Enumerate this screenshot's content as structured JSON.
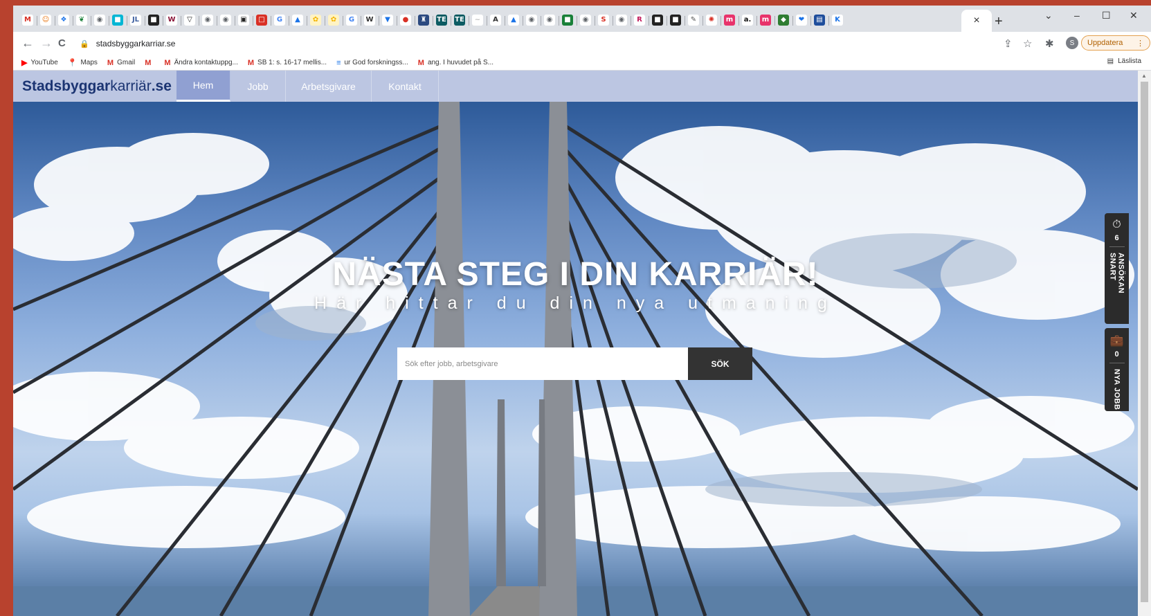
{
  "browser": {
    "tab_favicons": [
      {
        "icon": "gmail-icon",
        "glyph": "M",
        "bg": "#ffffff",
        "fg": "#d93025"
      },
      {
        "icon": "smiley-icon",
        "glyph": "☺",
        "bg": "#ffffff",
        "fg": "#e8710a"
      },
      {
        "icon": "bird-icon",
        "glyph": "❖",
        "bg": "#ffffff",
        "fg": "#1a73e8"
      },
      {
        "icon": "leaf-icon",
        "glyph": "❦",
        "bg": "#ffffff",
        "fg": "#188038"
      },
      {
        "icon": "globe-icon",
        "glyph": "◉",
        "bg": "#ffffff",
        "fg": "#5f6368"
      },
      {
        "icon": "chat-icon",
        "glyph": "■",
        "bg": "#00b6d4",
        "fg": "#ffffff"
      },
      {
        "icon": "jl-icon",
        "glyph": "JL",
        "bg": "#ffffff",
        "fg": "#3d5fa0"
      },
      {
        "icon": "dark-square-icon",
        "glyph": "■",
        "bg": "#222222",
        "fg": "#ffffff"
      },
      {
        "icon": "word-w-icon",
        "glyph": "W",
        "bg": "#ffffff",
        "fg": "#8a1538"
      },
      {
        "icon": "shield-icon",
        "glyph": "▽",
        "bg": "#ffffff",
        "fg": "#222222"
      },
      {
        "icon": "globe-icon",
        "glyph": "◉",
        "bg": "#ffffff",
        "fg": "#5f6368"
      },
      {
        "icon": "globe-icon",
        "glyph": "◉",
        "bg": "#ffffff",
        "fg": "#5f6368"
      },
      {
        "icon": "cup-icon",
        "glyph": "▣",
        "bg": "#ffffff",
        "fg": "#222222"
      },
      {
        "icon": "red-square-icon",
        "glyph": "□",
        "bg": "#d93025",
        "fg": "#ffffff"
      },
      {
        "icon": "google-icon",
        "glyph": "G",
        "bg": "#ffffff",
        "fg": "#4285f4"
      },
      {
        "icon": "drive-icon",
        "glyph": "▲",
        "bg": "#ffffff",
        "fg": "#1a73e8"
      },
      {
        "icon": "flower-icon",
        "glyph": "✿",
        "bg": "#fff3c4",
        "fg": "#f4b400"
      },
      {
        "icon": "flower-icon",
        "glyph": "✿",
        "bg": "#fff3c4",
        "fg": "#f4b400"
      },
      {
        "icon": "google-icon",
        "glyph": "G",
        "bg": "#ffffff",
        "fg": "#4285f4"
      },
      {
        "icon": "wikipedia-icon",
        "glyph": "W",
        "bg": "#ffffff",
        "fg": "#333333"
      },
      {
        "icon": "bookmark-icon",
        "glyph": "▼",
        "bg": "#ffffff",
        "fg": "#1a73e8"
      },
      {
        "icon": "red-circle-icon",
        "glyph": "●",
        "bg": "#ffffff",
        "fg": "#d93025"
      },
      {
        "icon": "crest-icon",
        "glyph": "♜",
        "bg": "#2c4a80",
        "fg": "#ffffff"
      },
      {
        "icon": "te-icon",
        "glyph": "TE",
        "bg": "#0d5c63",
        "fg": "#ffffff"
      },
      {
        "icon": "te-icon",
        "glyph": "TE",
        "bg": "#0d5c63",
        "fg": "#ffffff"
      },
      {
        "icon": "faded-icon",
        "glyph": "~",
        "bg": "#ffffff",
        "fg": "#c0c0c0"
      },
      {
        "icon": "letter-a-icon",
        "glyph": "A",
        "bg": "#ffffff",
        "fg": "#333333"
      },
      {
        "icon": "drive-icon",
        "glyph": "▲",
        "bg": "#ffffff",
        "fg": "#1a73e8"
      },
      {
        "icon": "globe-icon",
        "glyph": "◉",
        "bg": "#ffffff",
        "fg": "#5f6368"
      },
      {
        "icon": "globe-icon",
        "glyph": "◉",
        "bg": "#ffffff",
        "fg": "#5f6368"
      },
      {
        "icon": "green-square-icon",
        "glyph": "■",
        "bg": "#188038",
        "fg": "#ffffff"
      },
      {
        "icon": "globe-icon",
        "glyph": "◉",
        "bg": "#ffffff",
        "fg": "#5f6368"
      },
      {
        "icon": "letter-s-icon",
        "glyph": "S",
        "bg": "#ffffff",
        "fg": "#d93025"
      },
      {
        "icon": "globe-icon",
        "glyph": "◉",
        "bg": "#ffffff",
        "fg": "#5f6368"
      },
      {
        "icon": "r-icon",
        "glyph": "R",
        "bg": "#ffffff",
        "fg": "#c2185b"
      },
      {
        "icon": "dark-doc-icon",
        "glyph": "■",
        "bg": "#222222",
        "fg": "#ffffff"
      },
      {
        "icon": "dark-doc-icon",
        "glyph": "■",
        "bg": "#222222",
        "fg": "#ffffff"
      },
      {
        "icon": "pen-icon",
        "glyph": "✎",
        "bg": "#ffffff",
        "fg": "#555555"
      },
      {
        "icon": "red-flower-icon",
        "glyph": "✺",
        "bg": "#ffffff",
        "fg": "#d93025"
      },
      {
        "icon": "pink-m-icon",
        "glyph": "m",
        "bg": "#e8336b",
        "fg": "#ffffff"
      },
      {
        "icon": "letter-a-icon",
        "glyph": "a.",
        "bg": "#ffffff",
        "fg": "#111111"
      },
      {
        "icon": "pink-m-icon",
        "glyph": "m",
        "bg": "#e8336b",
        "fg": "#ffffff"
      },
      {
        "icon": "map-pin-icon",
        "glyph": "◆",
        "bg": "#2f7d32",
        "fg": "#ffffff"
      },
      {
        "icon": "heart-icon",
        "glyph": "❤",
        "bg": "#ffffff",
        "fg": "#1a73e8"
      },
      {
        "icon": "blue-doc-icon",
        "glyph": "▤",
        "bg": "#1f4e9c",
        "fg": "#ffffff"
      },
      {
        "icon": "letter-k-icon",
        "glyph": "K",
        "bg": "#ffffff",
        "fg": "#1a73e8"
      }
    ],
    "active_tab_close": "×",
    "new_tab": "+",
    "window_controls": {
      "tab_search": "⌄",
      "minimize": "–",
      "maximize": "☐",
      "close": "✕"
    },
    "nav": {
      "back": "←",
      "forward": "→",
      "reload": "C"
    },
    "url": "stadsbyggarkarriar.se",
    "profile_initial": "S",
    "update_label": "Uppdatera",
    "update_menu": "⋮",
    "bookmarks": [
      {
        "icon": "youtube-icon",
        "glyph": "▶",
        "color": "#ff0000",
        "label": "YouTube"
      },
      {
        "icon": "maps-icon",
        "glyph": "📍",
        "color": "#ea4335",
        "label": "Maps"
      },
      {
        "icon": "gmail-icon",
        "glyph": "M",
        "color": "#d93025",
        "label": "Gmail"
      },
      {
        "icon": "gmail-icon",
        "glyph": "M",
        "color": "#d93025",
        "label": ""
      },
      {
        "icon": "gmail-icon",
        "glyph": "M",
        "color": "#d93025",
        "label": "Ändra kontaktuppg..."
      },
      {
        "icon": "gmail-icon",
        "glyph": "M",
        "color": "#d93025",
        "label": "SB 1: s. 16-17 mellis..."
      },
      {
        "icon": "docs-icon",
        "glyph": "≡",
        "color": "#1a73e8",
        "label": "ur God forskningss..."
      },
      {
        "icon": "gmail-icon",
        "glyph": "M",
        "color": "#d93025",
        "label": "ang. I huvudet på S..."
      }
    ],
    "reading_list": "Läslista"
  },
  "site": {
    "logo_bold": "Stadsbyggar",
    "logo_light": "karriär",
    "logo_tld": ".se",
    "nav": [
      {
        "label": "Hem",
        "active": true
      },
      {
        "label": "Jobb",
        "active": false
      },
      {
        "label": "Arbetsgivare",
        "active": false
      },
      {
        "label": "Kontakt",
        "active": false
      }
    ],
    "hero_title": "NÄSTA STEG I DIN KARRIÄR!",
    "hero_subtitle": "Här hittar du din nya utmaning",
    "search_placeholder": "Sök efter jobb, arbetsgivare",
    "search_button": "SÖK",
    "widgets": [
      {
        "icon": "stopwatch-icon",
        "glyph": "⏱",
        "count": "6",
        "label": "ANSÖKAN SNART"
      },
      {
        "icon": "briefcase-icon",
        "glyph": "💼",
        "count": "0",
        "label": "NYA JOBB"
      }
    ]
  }
}
